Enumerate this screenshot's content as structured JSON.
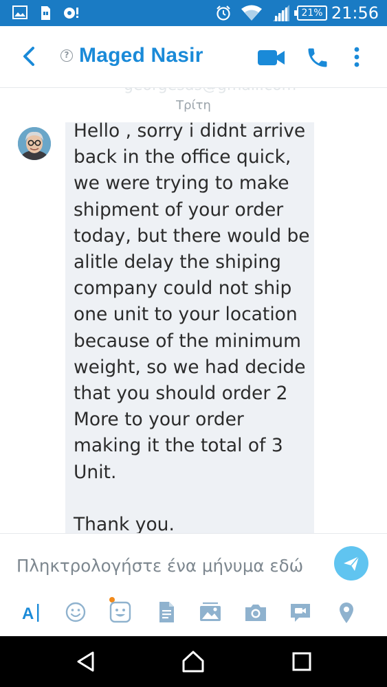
{
  "status_bar": {
    "battery": "21%",
    "time": "21:56"
  },
  "header": {
    "info_glyph": "?",
    "contact_name": "Maged Nasir"
  },
  "chat": {
    "faded_previous": "georgesds@gmail.com",
    "day_label": "Τρίτη",
    "message": "Hello , sorry i didnt arrive\nback in the office quick,\nwe were trying to make\nshipment of your order\ntoday, but there would be\nalitle delay the shiping\ncompany could not ship\none unit to your location\nbecause of the minimum\nweight, so we had decide\nthat you should order 2\nMore to your order\nmaking it the total of 3\nUnit.\n\nThank you."
  },
  "composer": {
    "placeholder": "Πληκτρολογήστε ένα μήνυμα εδώ",
    "text_format_glyph": "A"
  },
  "colors": {
    "status_bar": "#1a7bc4",
    "accent": "#1a8ad8",
    "send_button": "#60c4f0",
    "bubble": "#eef1f5",
    "notification_dot": "#f28a1a"
  },
  "icons": {
    "status": [
      "image-icon",
      "sim-icon",
      "media-icon",
      "alarm-icon",
      "wifi-icon",
      "signal-icon",
      "battery-icon"
    ],
    "header": [
      "back-arrow-icon",
      "info-icon",
      "video-call-icon",
      "phone-call-icon",
      "more-vert-icon"
    ],
    "toolbar": [
      "text-format-icon",
      "emoji-icon",
      "mojis-icon",
      "file-icon",
      "gallery-icon",
      "camera-icon",
      "video-message-icon",
      "location-icon"
    ],
    "nav": [
      "nav-back-icon",
      "nav-home-icon",
      "nav-recents-icon"
    ]
  }
}
